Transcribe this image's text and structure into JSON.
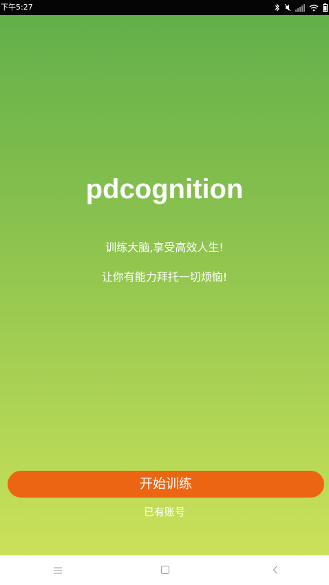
{
  "status_bar": {
    "time": "下午5:27",
    "icons": [
      "bluetooth-icon",
      "mute-icon",
      "signal-icon",
      "wifi-icon",
      "battery-icon"
    ]
  },
  "splash": {
    "app_title": "pdcognition",
    "tagline_1": "训练大脑,享受高效人生!",
    "tagline_2": "让你有能力拜托一切烦恼!",
    "start_button_label": "开始训练",
    "login_link_label": "已有账号"
  },
  "nav_bar": {
    "icons": [
      "menu-icon",
      "home-icon",
      "back-icon"
    ]
  },
  "colors": {
    "gradient_top": "#62b04a",
    "gradient_bottom": "#cbe15a",
    "accent": "#ec6512",
    "text": "#ffffff"
  }
}
